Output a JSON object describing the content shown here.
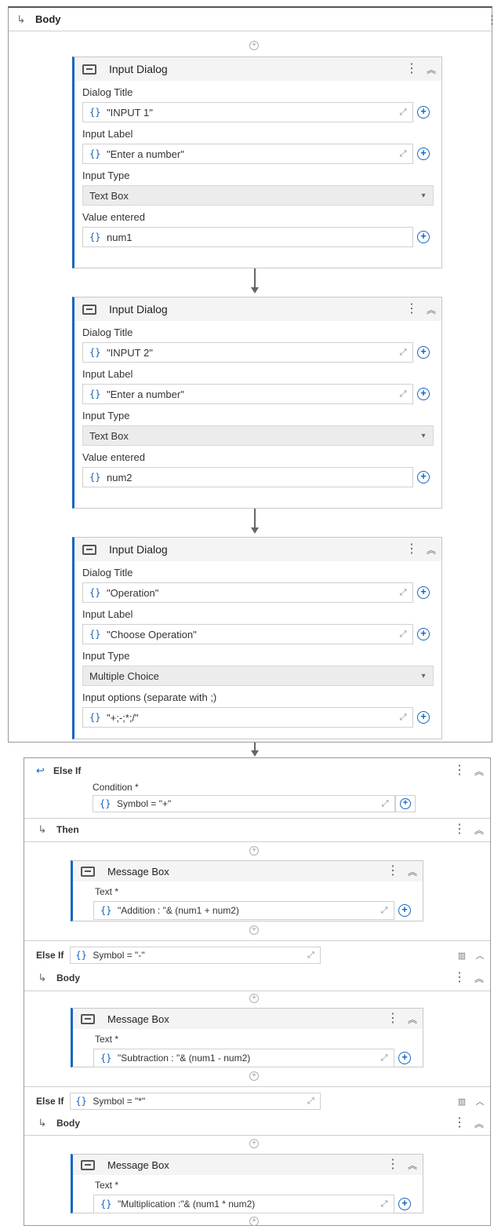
{
  "top": {
    "body_label": "Body",
    "cards": [
      {
        "title": "Input Dialog",
        "fields": [
          {
            "label": "Dialog Title",
            "kind": "expr",
            "value": "\"INPUT 1\""
          },
          {
            "label": "Input Label",
            "kind": "expr",
            "value": "\"Enter a number\""
          },
          {
            "label": "Input Type",
            "kind": "select",
            "value": "Text Box"
          },
          {
            "label": "Value entered",
            "kind": "var",
            "value": "num1"
          }
        ]
      },
      {
        "title": "Input Dialog",
        "fields": [
          {
            "label": "Dialog Title",
            "kind": "expr",
            "value": "\"INPUT 2\""
          },
          {
            "label": "Input Label",
            "kind": "expr",
            "value": "\"Enter a number\""
          },
          {
            "label": "Input Type",
            "kind": "select",
            "value": "Text Box"
          },
          {
            "label": "Value entered",
            "kind": "var",
            "value": "num2"
          }
        ]
      },
      {
        "title": "Input Dialog",
        "fields": [
          {
            "label": "Dialog Title",
            "kind": "expr",
            "value": "\"Operation\""
          },
          {
            "label": "Input Label",
            "kind": "expr",
            "value": "\"Choose Operation\""
          },
          {
            "label": "Input Type",
            "kind": "select",
            "value": "Multiple Choice"
          },
          {
            "label": "Input options (separate with ;)",
            "kind": "expr",
            "value": "\"+;-;*;/\""
          }
        ]
      }
    ]
  },
  "bottom": {
    "else_if_title": "Else If",
    "condition_label": "Condition *",
    "condition_value": "Symbol = \"+\"",
    "then_label": "Then",
    "message_box_1": {
      "title": "Message Box",
      "text_label": "Text *",
      "value": "\"Addition : \"& (num1 + num2)"
    },
    "else_if_2": {
      "label": "Else If",
      "condition": "Symbol = \"-\""
    },
    "body_label_2": "Body",
    "message_box_2": {
      "title": "Message Box",
      "text_label": "Text *",
      "value": "\"Subtraction : \"& (num1 - num2)"
    },
    "else_if_3": {
      "label": "Else If",
      "condition": "Symbol = \"*\""
    },
    "body_label_3": "Body",
    "message_box_3": {
      "title": "Message Box",
      "text_label": "Text *",
      "value": "\"Multiplication :\"& (num1 * num2)"
    }
  },
  "icons": {
    "brace": "{ }",
    "expand": "⤢",
    "plus": "+",
    "kebab": "⋮",
    "collapse": "⌃",
    "chevron": "⌄",
    "seq_arrow": "↳",
    "trash": "🗑",
    "caret_up": "^"
  }
}
